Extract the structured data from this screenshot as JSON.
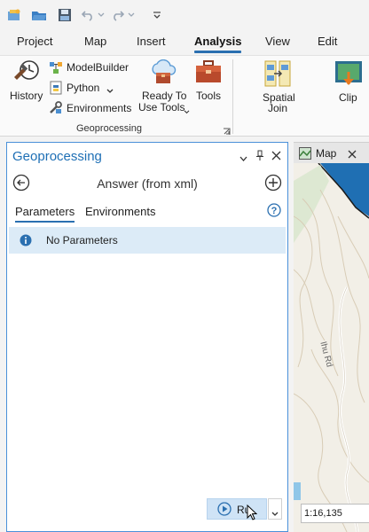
{
  "quick_access": {
    "icons": [
      "new-project-icon",
      "open-project-icon",
      "save-project-icon",
      "undo-icon",
      "redo-icon",
      "customize-qat-icon"
    ]
  },
  "ribbon_tabs": [
    "Project",
    "Map",
    "Insert",
    "Analysis",
    "View",
    "Edit"
  ],
  "active_tab": "Analysis",
  "ribbon": {
    "history": "History",
    "modelbuilder": "ModelBuilder",
    "python": "Python",
    "environments": "Environments",
    "ready_to_use_1": "Ready To",
    "ready_to_use_2": "Use Tools",
    "tools": "Tools",
    "group_label": "Geoprocessing",
    "spatial_join_1": "Spatial",
    "spatial_join_2": "Join",
    "clip": "Clip"
  },
  "gp_pane": {
    "title": "Geoprocessing",
    "tool_title": "Answer (from xml)",
    "tabs": [
      "Parameters",
      "Environments"
    ],
    "active_subtab": "Parameters",
    "message": "No Parameters",
    "run_label": "Ru"
  },
  "map_pane": {
    "tab_label": "Map",
    "road_label": "Ihu Rd",
    "scale": "1:16,135"
  },
  "colors": {
    "accent": "#2a6fb0",
    "pane_title": "#1e6fb5",
    "message_bg": "#dcebf7",
    "map_bg": "#f2efe7"
  }
}
